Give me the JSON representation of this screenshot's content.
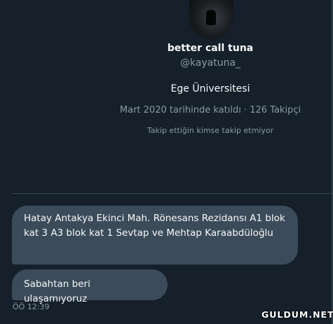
{
  "profile": {
    "name": "better call tuna",
    "handle": "@kayatuna_",
    "bio": "Ege Üniversitesi",
    "meta": "Mart 2020 tarihinde katıldı · 126 Takipçi",
    "no_followers_note": "Takip ettiğin kimse takip etmiyor"
  },
  "messages": [
    {
      "text": "Hatay Antakya Ekinci Mah. Rönesans Rezidansı A1 blok kat 3 A3 blok kat 1 Sevtap ve Mehtap Karaabdüloğlu"
    },
    {
      "text": "Sabahtan beri ulaşamıyoruz"
    }
  ],
  "timestamp": "ÖÖ 12:39",
  "watermark": "GULDUM.NET",
  "colors": {
    "background": "#15202b",
    "bubble": "#3b4b5a",
    "muted": "#8b98a5"
  }
}
